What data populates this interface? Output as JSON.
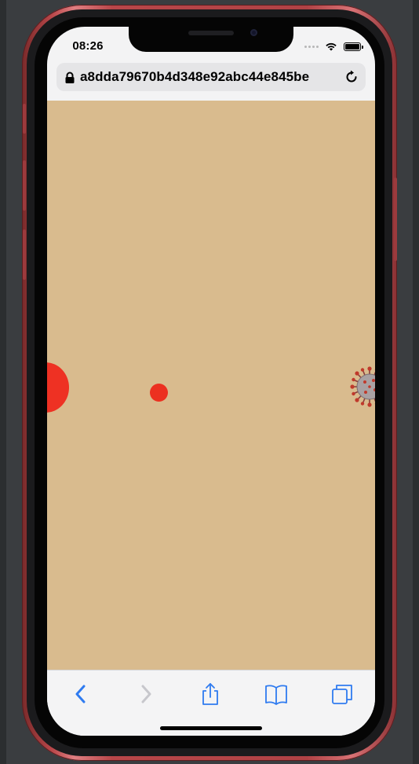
{
  "status_bar": {
    "time": "08:26",
    "icons": [
      "signal-icon",
      "wifi-icon",
      "battery-icon"
    ]
  },
  "address_bar": {
    "url": "a8dda79670b4d348e92abc44e845be",
    "icons": [
      "lock-icon",
      "reload-icon"
    ]
  },
  "web_content": {
    "background_color": "#d9bb8e",
    "objects": [
      {
        "name": "large red circle",
        "color": "#ee3123"
      },
      {
        "name": "small red circle",
        "color": "#ec3020"
      },
      {
        "name": "virus",
        "icon": "virus-icon"
      }
    ]
  },
  "toolbar": {
    "buttons": [
      {
        "name": "back",
        "icon": "chevron-left-icon",
        "enabled": true,
        "color": "#2f7bf0"
      },
      {
        "name": "forward",
        "icon": "chevron-right-icon",
        "enabled": false,
        "color": "#c7c7cc"
      },
      {
        "name": "share",
        "icon": "share-icon",
        "enabled": true,
        "color": "#2f7bf0"
      },
      {
        "name": "bookmarks",
        "icon": "book-icon",
        "enabled": true,
        "color": "#2f7bf0"
      },
      {
        "name": "tabs",
        "icon": "tabs-icon",
        "enabled": true,
        "color": "#2f7bf0"
      }
    ]
  },
  "device": {
    "frame_color": "#b04245"
  }
}
